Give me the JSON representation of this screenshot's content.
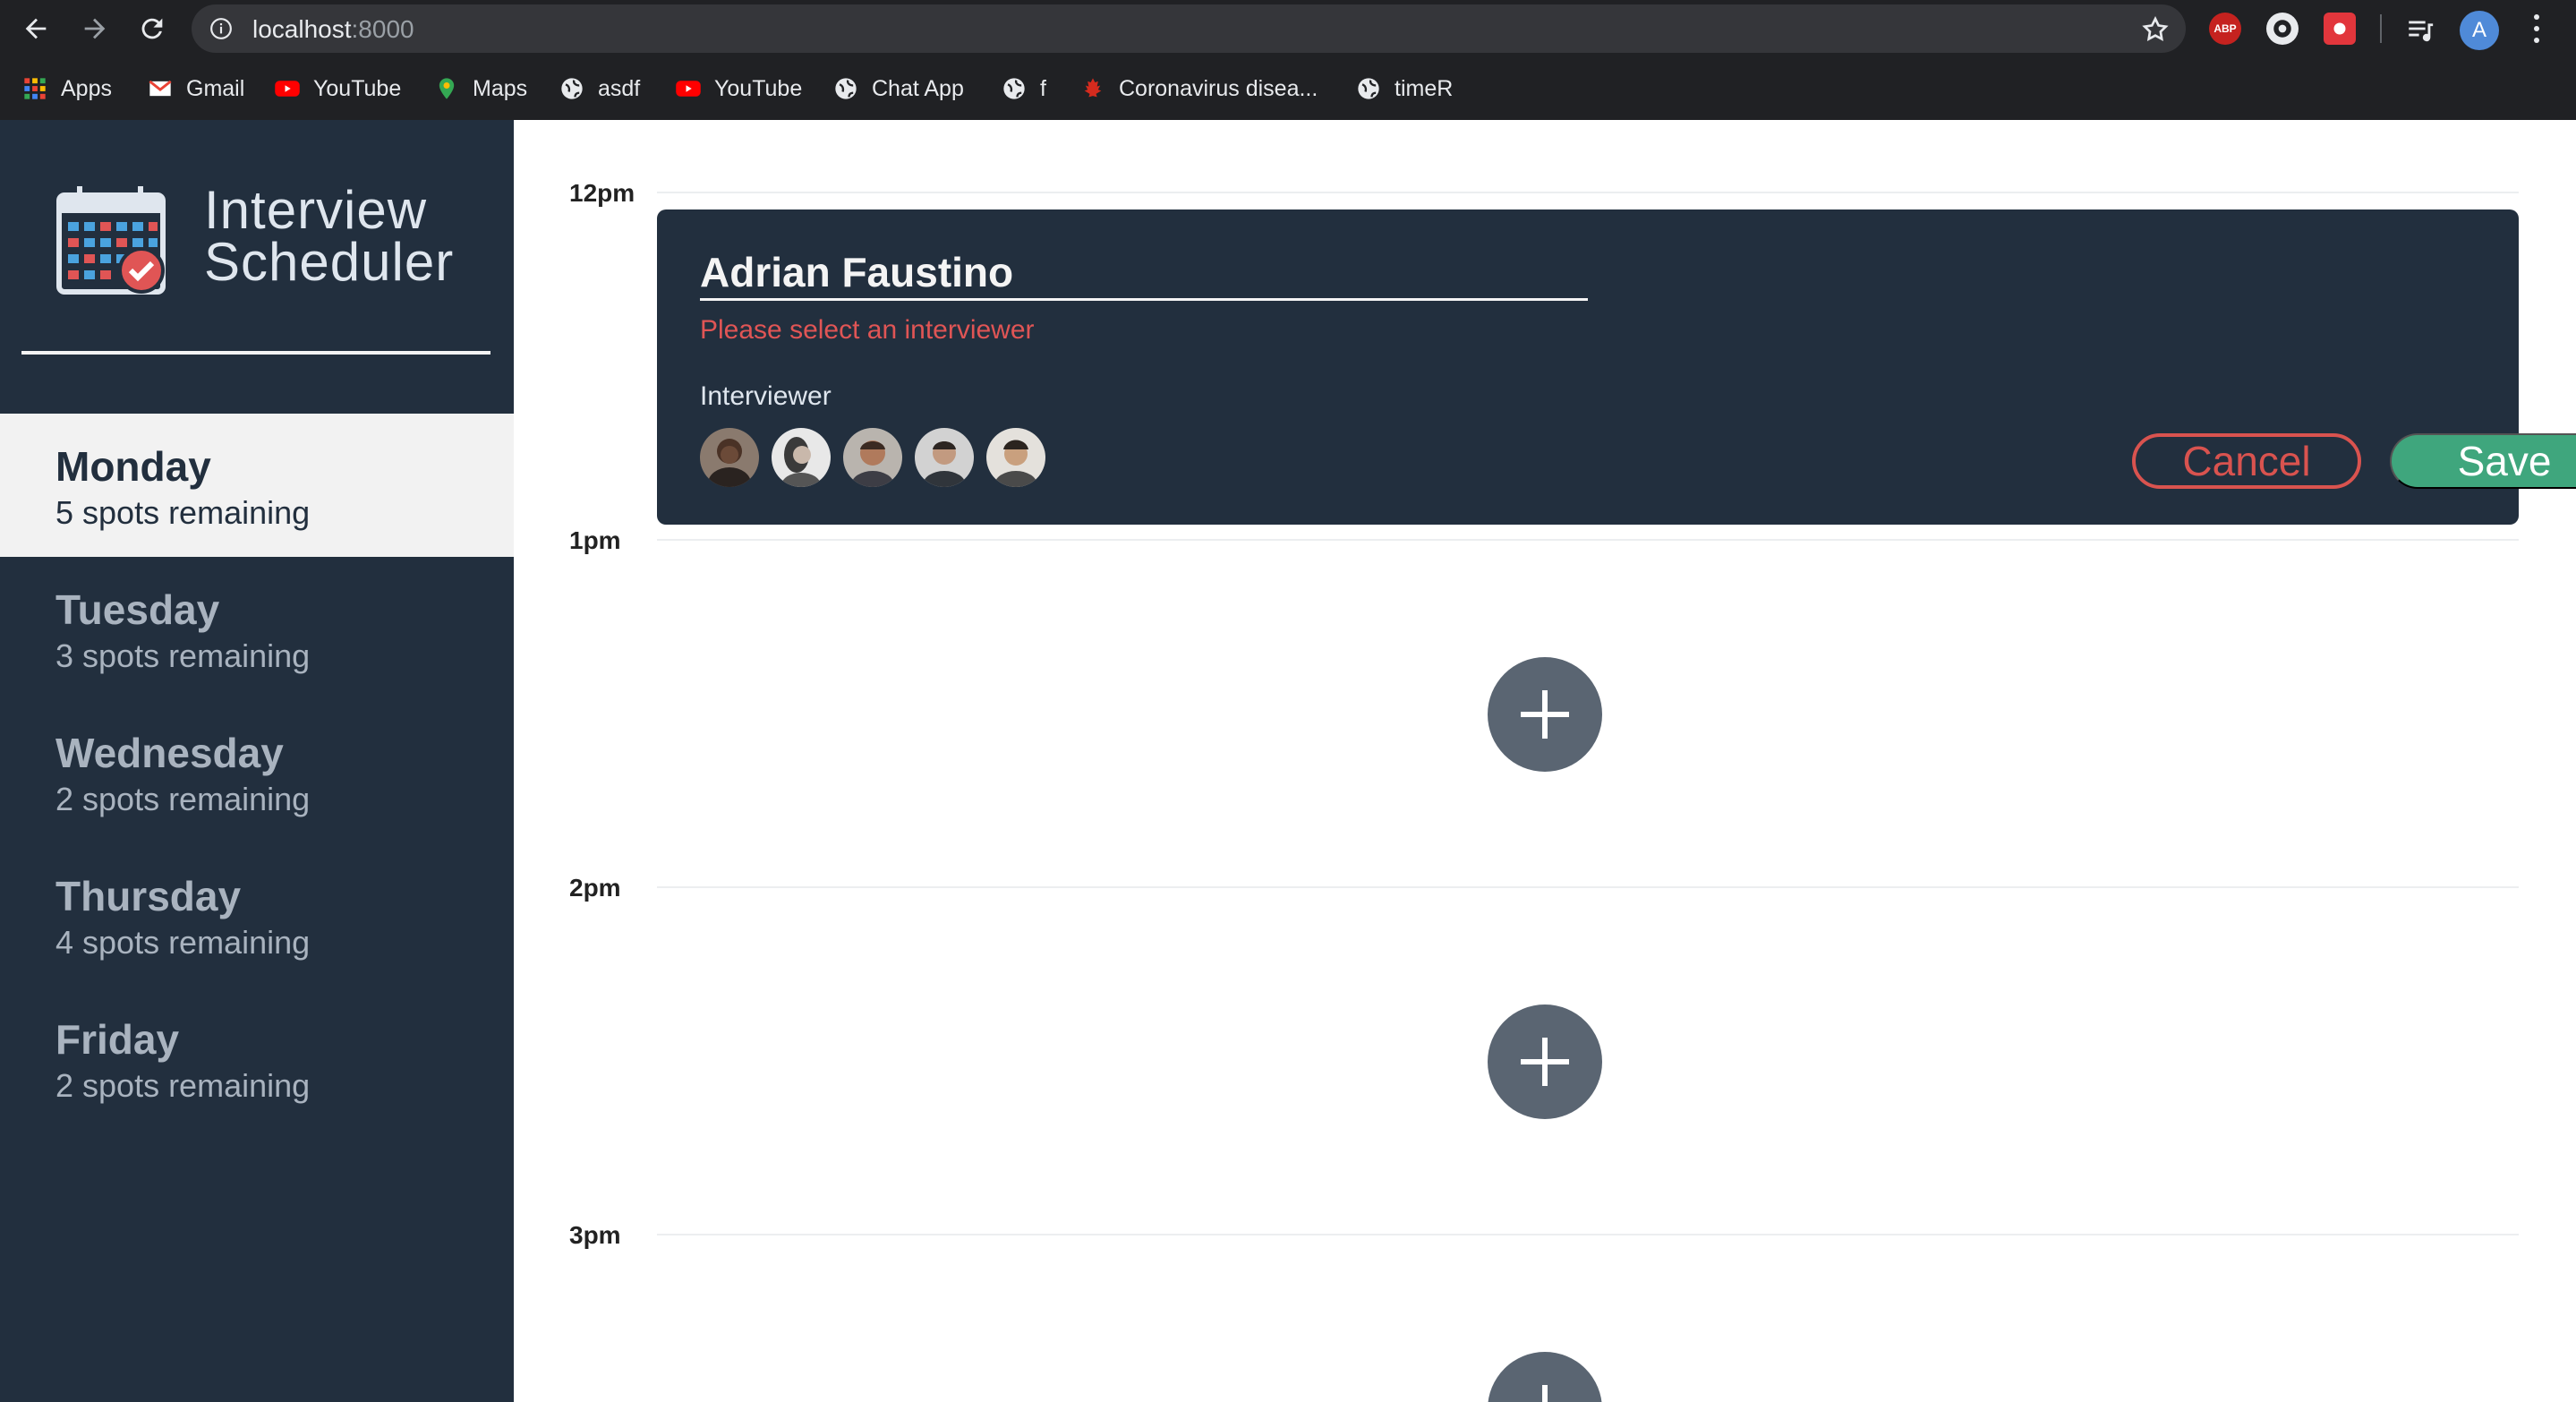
{
  "browser": {
    "url_host": "localhost",
    "url_port": ":8000",
    "avatar_letter": "A",
    "abp_label": "ABP",
    "bookmarks": [
      {
        "label": "Apps",
        "icon": "apps-grid-icon"
      },
      {
        "label": "Gmail",
        "icon": "gmail-icon"
      },
      {
        "label": "YouTube",
        "icon": "youtube-icon"
      },
      {
        "label": "Maps",
        "icon": "maps-pin-icon"
      },
      {
        "label": "asdf",
        "icon": "globe-icon"
      },
      {
        "label": "YouTube",
        "icon": "youtube-icon"
      },
      {
        "label": "Chat App",
        "icon": "globe-icon"
      },
      {
        "label": "f",
        "icon": "globe-icon"
      },
      {
        "label": "Coronavirus disea...",
        "icon": "maple-leaf-icon"
      },
      {
        "label": "timeR",
        "icon": "globe-icon"
      }
    ]
  },
  "sidebar": {
    "brand_line1": "Interview",
    "brand_line2": "Scheduler",
    "days": [
      {
        "name": "Monday",
        "spots": "5 spots remaining",
        "selected": true
      },
      {
        "name": "Tuesday",
        "spots": "3 spots remaining",
        "selected": false
      },
      {
        "name": "Wednesday",
        "spots": "2 spots remaining",
        "selected": false
      },
      {
        "name": "Thursday",
        "spots": "4 spots remaining",
        "selected": false
      },
      {
        "name": "Friday",
        "spots": "2 spots remaining",
        "selected": false
      }
    ]
  },
  "schedule": {
    "slots": [
      "12pm",
      "1pm",
      "2pm",
      "3pm"
    ],
    "form": {
      "student_name": "Adrian Faustino",
      "error": "Please select an interviewer",
      "interviewer_label": "Interviewer",
      "cancel_label": "Cancel",
      "save_label": "Save"
    }
  },
  "colors": {
    "sidebar_bg": "#222f3e",
    "save_green": "#3fa67d",
    "cancel_red": "#d9534f",
    "error_red": "#e05555",
    "add_button": "#5a6572"
  }
}
